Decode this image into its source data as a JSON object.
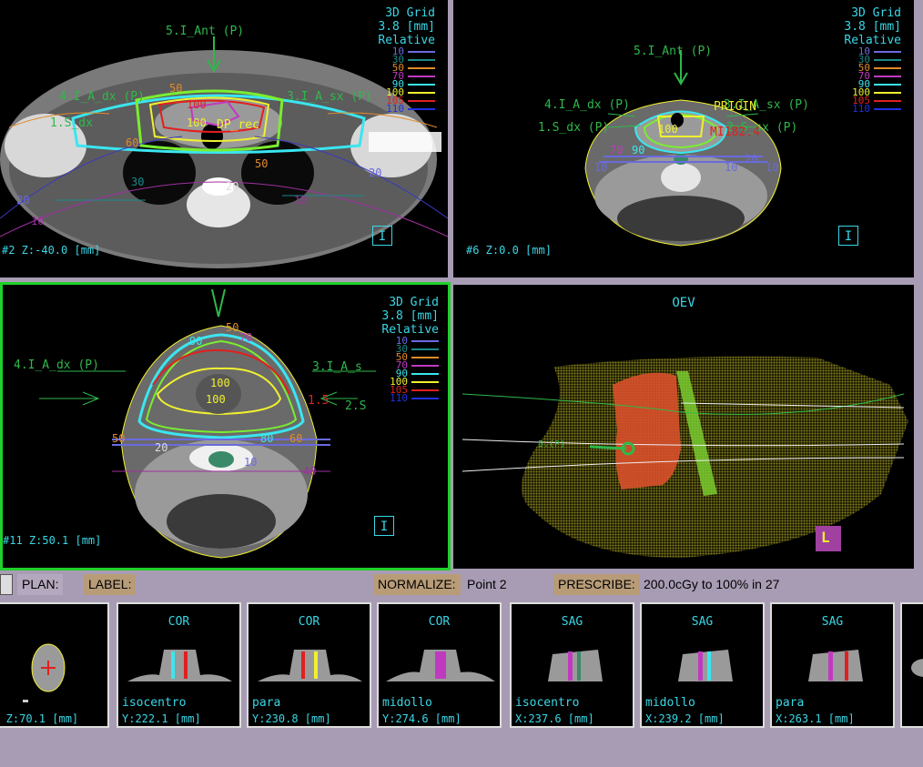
{
  "viewports": {
    "axial_top": {
      "label": "#2 Z:-40.0 [mm]",
      "grid": [
        "3D Grid",
        "3.8 [mm]",
        "Relative"
      ],
      "beams": [
        "5.I_Ant (P)",
        "4.I_A_dx (P)",
        "3.I_A_sx (P)",
        "1.S_dx",
        "DP_rec"
      ],
      "isodose_labels": [
        "50",
        "100",
        "100",
        "60",
        "50",
        "20",
        "20",
        "10",
        "10",
        "20",
        "30"
      ],
      "orientation": "I"
    },
    "axial_top_right": {
      "label": "#6 Z:0.0 [mm]",
      "grid": [
        "3D Grid",
        "3.8 [mm]",
        "Relative"
      ],
      "beams": [
        "5.I_Ant (P)",
        "4.I_A_dx (P)",
        "3.I_A_sx (P)",
        "1.S_dx (P)",
        "2.S_sx (P)",
        "PRIGIN",
        "MI182.4"
      ],
      "isodose_labels": [
        "100",
        "70",
        "90",
        "10",
        "10",
        "10",
        "20"
      ],
      "orientation": "I"
    },
    "axial_bottom_left": {
      "label": "#11 Z:50.1 [mm]",
      "grid": [
        "3D Grid",
        "3.8 [mm]",
        "Relative"
      ],
      "beams": [
        "4.I_A_dx (P)",
        "3.I_A_s",
        "2.S",
        "1.5"
      ],
      "isodose_labels": [
        "100",
        "100",
        "90",
        "70",
        "50",
        "80",
        "20",
        "10",
        "40",
        "50",
        "60"
      ],
      "orientation": "I"
    },
    "oev": {
      "title": "OEV",
      "beam_label": "5.(P)",
      "orientation": "L"
    }
  },
  "legend": {
    "values": [
      "10",
      "30",
      "50",
      "70",
      "90",
      "100",
      "105",
      "110"
    ],
    "colors": [
      "#6a6ae0",
      "#1a8a8a",
      "#e08a2a",
      "#c03ac0",
      "#3ae6f0",
      "#f0f030",
      "#e02020",
      "#2030e0"
    ]
  },
  "plan_bar": {
    "plan_label": "PLAN:",
    "label_label": "LABEL:",
    "label_value": "",
    "normalize_label": "NORMALIZE:",
    "normalize_value": "Point 2",
    "prescribe_label": "PRESCRIBE:",
    "prescribe_value": "200.0cGy to 100% in 27"
  },
  "thumbnails": [
    {
      "title": "",
      "name": "",
      "coord": "13 Z:70.1 [mm]"
    },
    {
      "title": "COR",
      "name": "isocentro",
      "coord": "Y:222.1 [mm]"
    },
    {
      "title": "COR",
      "name": "para",
      "coord": "Y:230.8 [mm]"
    },
    {
      "title": "COR",
      "name": "midollo",
      "coord": "Y:274.6 [mm]"
    },
    {
      "title": "SAG",
      "name": "isocentro",
      "coord": "X:237.6 [mm]"
    },
    {
      "title": "SAG",
      "name": "midollo",
      "coord": "X:239.2 [mm]"
    },
    {
      "title": "SAG",
      "name": "para",
      "coord": "X:263.1 [mm]"
    }
  ]
}
